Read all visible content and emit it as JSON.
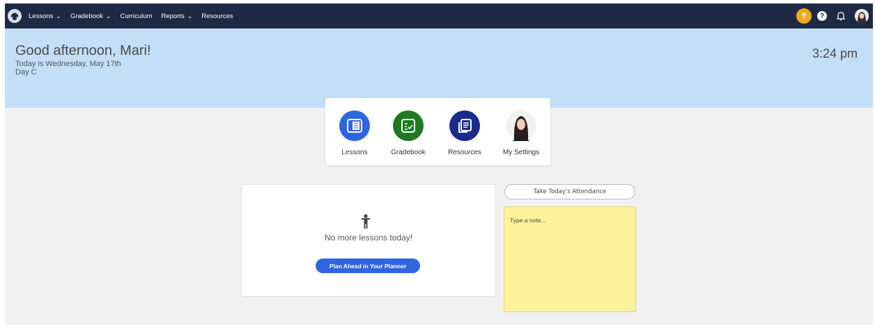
{
  "nav": {
    "items": [
      {
        "label": "Lessons",
        "has_menu": true
      },
      {
        "label": "Gradebook",
        "has_menu": true
      },
      {
        "label": "Curriculum",
        "has_menu": false
      },
      {
        "label": "Reports",
        "has_menu": true
      },
      {
        "label": "Resources",
        "has_menu": false
      }
    ],
    "chevron": "⌄",
    "help_glyph": "?",
    "icons": [
      "logo-icon",
      "upgrade-icon",
      "help-icon",
      "bell-icon",
      "user-avatar"
    ]
  },
  "banner": {
    "greeting": "Good afternoon, Mari!",
    "date": "Today is Wednesday, May 17th",
    "day": "Day C",
    "time": "3:24 pm"
  },
  "quick_access": [
    {
      "label": "Lessons",
      "icon": "lessons-icon",
      "color": "#2f66e0"
    },
    {
      "label": "Gradebook",
      "icon": "gradebook-icon",
      "color": "#1f7a1f"
    },
    {
      "label": "Resources",
      "icon": "resources-icon",
      "color": "#1a2b8c"
    },
    {
      "label": "My Settings",
      "icon": "settings-avatar-icon",
      "color": "#f1f1f1"
    }
  ],
  "lessons": {
    "empty_message": "No more lessons today!",
    "plan_button": "Plan Ahead in Your Planner"
  },
  "attendance_button": "Take Today's Attendance",
  "note": {
    "placeholder": "Type a note...",
    "value": ""
  },
  "colors": {
    "nav_bg": "#1e2a44",
    "banner_bg": "#c3dff8",
    "upgrade": "#f0a91b",
    "primary_button": "#2f66e0",
    "note_bg": "#fcf29b"
  }
}
